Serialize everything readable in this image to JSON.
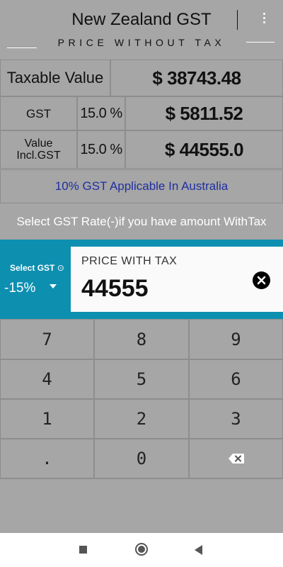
{
  "header": {
    "title": "New Zealand GST",
    "subtitle": "PRICE WITHOUT TAX",
    "menu_icon": "more-vert-icon"
  },
  "results": {
    "taxable": {
      "label": "Taxable Value",
      "value": "$ 38743.48"
    },
    "gst": {
      "label": "GST",
      "rate": "15.0 %",
      "value": "$ 5811.52"
    },
    "incl": {
      "label_line1": "Value",
      "label_line2": "Incl.GST",
      "rate": "15.0 %",
      "value": "$ 44555.0"
    }
  },
  "info_text": "10% GST  Applicable In Australia",
  "hint_text": "Select GST Rate(-)if you have amount WithTax",
  "selector": {
    "label": "Select GST",
    "help_icon": "help-icon",
    "value": "-15%",
    "caret_icon": "dropdown-caret-icon"
  },
  "input": {
    "label": "PRICE WITH TAX",
    "value": "44555",
    "clear_icon": "clear-circle-icon"
  },
  "keypad": {
    "keys": [
      "7",
      "8",
      "9",
      "4",
      "5",
      "6",
      "1",
      "2",
      "3",
      ".",
      "0"
    ],
    "backspace_icon": "backspace-icon"
  },
  "navbar": {
    "recents_icon": "recents-square-icon",
    "home_icon": "home-circle-icon",
    "back_icon": "back-triangle-icon"
  },
  "colors": {
    "background": "#a6a6a6",
    "accent": "#0d8fb0",
    "info_text": "#1f2fa0"
  }
}
